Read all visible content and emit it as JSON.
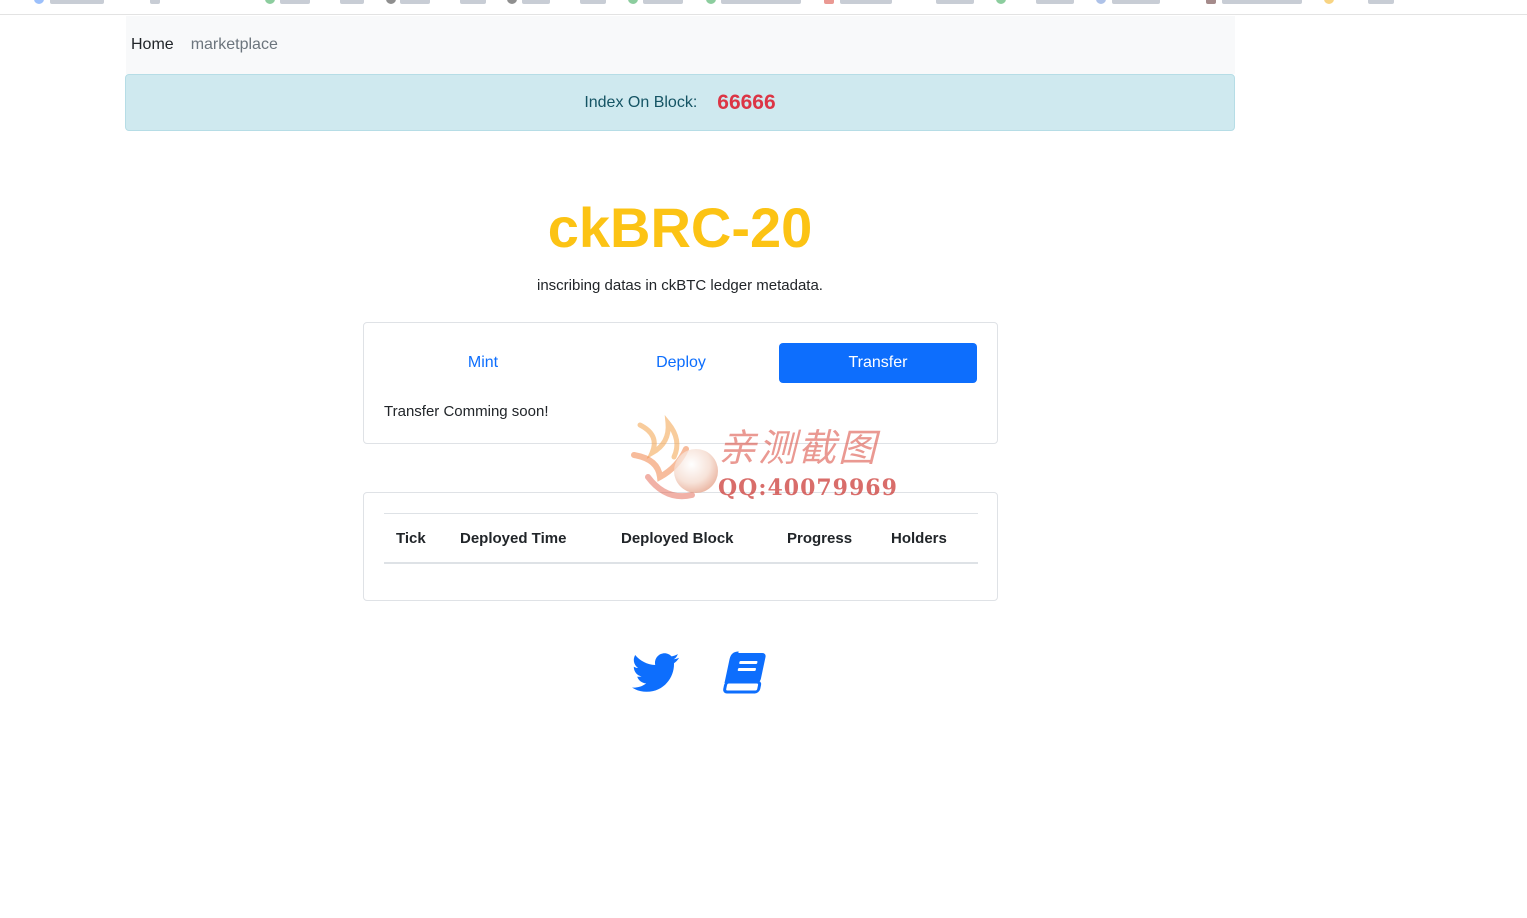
{
  "navbar": {
    "home_label": "Home",
    "links": [
      "marketplace"
    ]
  },
  "alert": {
    "label": "Index On Block:",
    "value": "66666"
  },
  "hero": {
    "title": "ckBRC-20",
    "subtitle": "inscribing datas in ckBTC ledger metadata."
  },
  "tabs": {
    "items": [
      {
        "label": "Mint",
        "active": false
      },
      {
        "label": "Deploy",
        "active": false
      },
      {
        "label": "Transfer",
        "active": true
      }
    ],
    "content": "Transfer Comming soon!"
  },
  "table": {
    "columns": [
      "Tick",
      "Deployed Time",
      "Deployed Block",
      "Progress",
      "Holders"
    ],
    "rows": []
  },
  "footer": {
    "icons": [
      "twitter-icon",
      "book-icon"
    ]
  },
  "watermark": {
    "title": "亲测截图",
    "qq": "QQ:40079969"
  },
  "colors": {
    "primary": "#0d6efd",
    "brand_yellow": "#fcc314",
    "alert_bg": "#cfe9ef",
    "alert_text": "#155464",
    "danger": "#dc3545"
  }
}
